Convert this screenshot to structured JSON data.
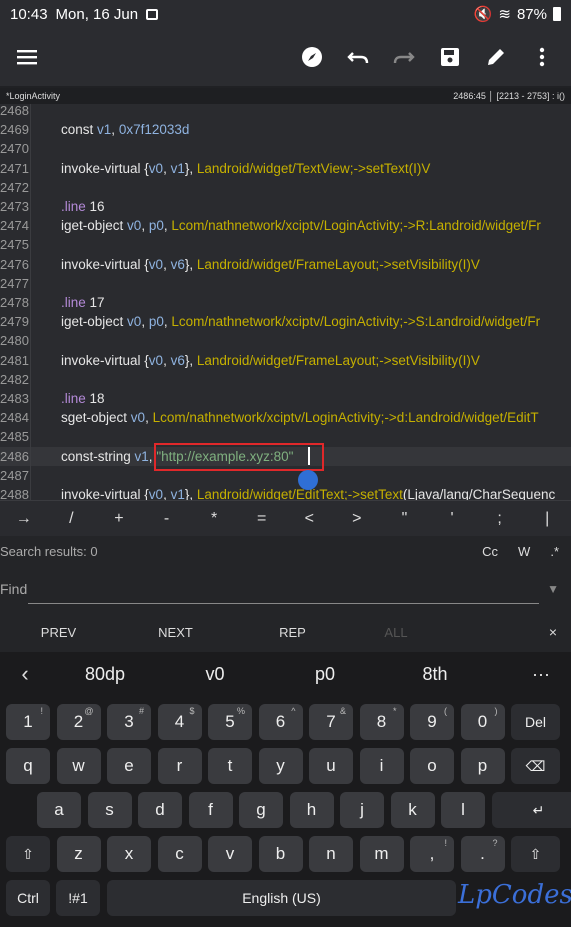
{
  "status": {
    "time": "10:43",
    "date": "Mon, 16 Jun",
    "battery": "87%"
  },
  "toolbar": {
    "icons": [
      "menu-icon",
      "compass-icon",
      "undo-icon",
      "redo-icon",
      "save-icon",
      "edit-icon",
      "more-vert-icon"
    ]
  },
  "file": {
    "name": "*LoginActivity",
    "position": "2486:45 │ [2213 - 2753] : i()"
  },
  "editor": {
    "lines": [
      {
        "n": "2468",
        "code": ""
      },
      {
        "n": "2469",
        "code": "const v1, 0x7f12033d"
      },
      {
        "n": "2470",
        "code": ""
      },
      {
        "n": "2471",
        "code": "invoke-virtual {v0, v1}, Landroid/widget/TextView;->setText(I)V"
      },
      {
        "n": "2472",
        "code": ""
      },
      {
        "n": "2473",
        "code": ".line 16"
      },
      {
        "n": "2474",
        "code": "iget-object v0, p0, Lcom/nathnetwork/xciptv/LoginActivity;->R:Landroid/widget/Fr"
      },
      {
        "n": "2475",
        "code": ""
      },
      {
        "n": "2476",
        "code": "invoke-virtual {v0, v6}, Landroid/widget/FrameLayout;->setVisibility(I)V"
      },
      {
        "n": "2477",
        "code": ""
      },
      {
        "n": "2478",
        "code": ".line 17"
      },
      {
        "n": "2479",
        "code": "iget-object v0, p0, Lcom/nathnetwork/xciptv/LoginActivity;->S:Landroid/widget/Fr"
      },
      {
        "n": "2480",
        "code": ""
      },
      {
        "n": "2481",
        "code": "invoke-virtual {v0, v6}, Landroid/widget/FrameLayout;->setVisibility(I)V"
      },
      {
        "n": "2482",
        "code": ""
      },
      {
        "n": "2483",
        "code": ".line 18"
      },
      {
        "n": "2484",
        "code": "sget-object v0, Lcom/nathnetwork/xciptv/LoginActivity;->d:Landroid/widget/EditT"
      },
      {
        "n": "2485",
        "code": ""
      },
      {
        "n": "2486",
        "code": "const-string v1, \"http://example.xyz:80\""
      },
      {
        "n": "2487",
        "code": ""
      },
      {
        "n": "2488",
        "code": "invoke-virtual {v0, v1}, Landroid/widget/EditText;->setText(Ljava/lang/CharSequenc"
      }
    ]
  },
  "symbols": [
    "→",
    "/",
    "+",
    "-",
    "*",
    "=",
    "<",
    ">",
    "\"",
    "'",
    ";",
    "|"
  ],
  "search": {
    "results": "Search results: 0",
    "options": [
      "Cc",
      "W",
      ".*"
    ],
    "find_label": "Find",
    "find_value": ""
  },
  "actions": {
    "prev": "PREV",
    "next": "NEXT",
    "rep": "REP",
    "all": "ALL",
    "close": "×"
  },
  "keyboard": {
    "suggestions": [
      "80dp",
      "v0",
      "p0",
      "8th"
    ],
    "row1": [
      {
        "k": "1",
        "s": "!"
      },
      {
        "k": "2",
        "s": "@"
      },
      {
        "k": "3",
        "s": "#"
      },
      {
        "k": "4",
        "s": "$"
      },
      {
        "k": "5",
        "s": "%"
      },
      {
        "k": "6",
        "s": "^"
      },
      {
        "k": "7",
        "s": "&"
      },
      {
        "k": "8",
        "s": "*"
      },
      {
        "k": "9",
        "s": "("
      },
      {
        "k": "0",
        "s": ")"
      }
    ],
    "del": "Del",
    "row2": [
      "q",
      "w",
      "e",
      "r",
      "t",
      "y",
      "u",
      "i",
      "o",
      "p"
    ],
    "row3": [
      "a",
      "s",
      "d",
      "f",
      "g",
      "h",
      "j",
      "k",
      "l"
    ],
    "row4": [
      "z",
      "x",
      "c",
      "v",
      "b",
      "n",
      "m"
    ],
    "row4_punct": [
      {
        "k": ",",
        "s": "!"
      },
      {
        "k": ".",
        "s": "?"
      }
    ],
    "ctrl": "Ctrl",
    "sym": "!#1",
    "space": "English (US)"
  },
  "watermark": "LpCodes"
}
